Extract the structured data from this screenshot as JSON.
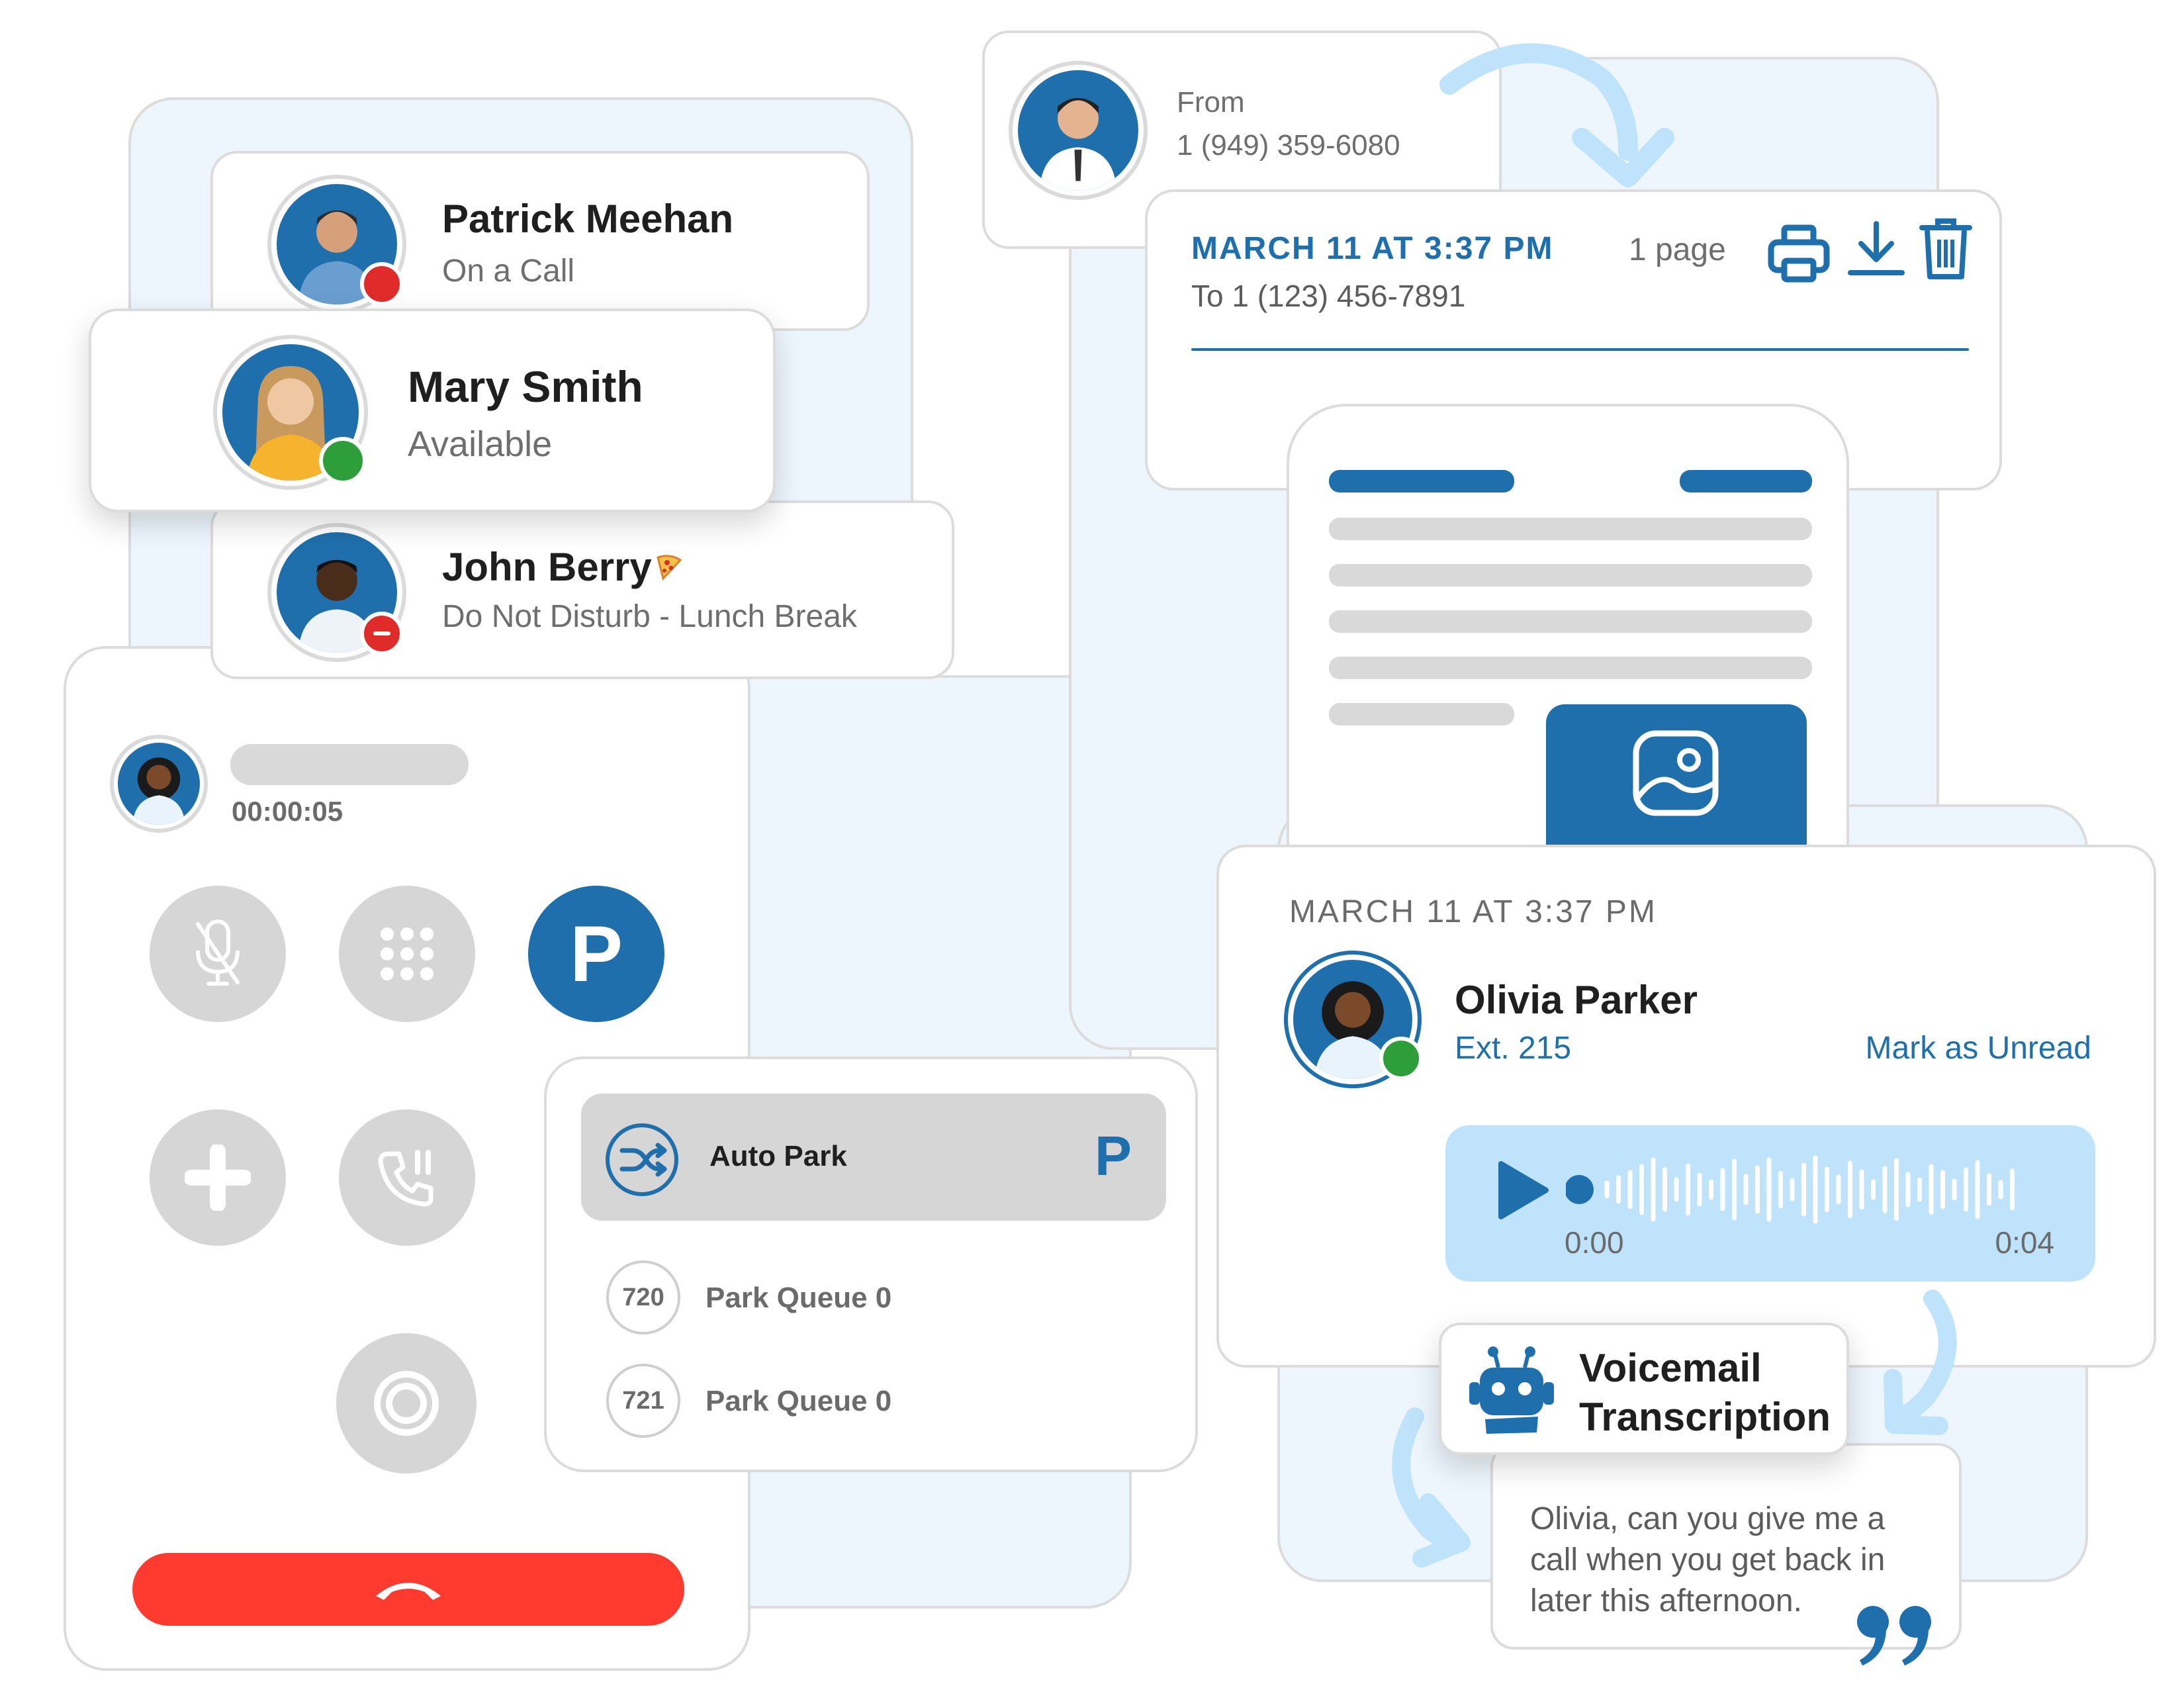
{
  "presence": {
    "contacts": [
      {
        "name": "Patrick Meehan",
        "status": "On a Call",
        "status_color": "#e02b2b"
      },
      {
        "name": "Mary Smith",
        "status": "Available",
        "status_color": "#2e9e3a"
      },
      {
        "name": "John Berry",
        "status": "Do Not Disturb - Lunch Break",
        "status_color": "#e02b2b",
        "emoji": "🍕"
      }
    ]
  },
  "call": {
    "timer": "00:00:05",
    "park_letter": "P",
    "colors": {
      "park": "#1e6fac",
      "hangup": "#ff3b30",
      "button": "#d6d6d6"
    }
  },
  "park_menu": {
    "auto_park_label": "Auto Park",
    "auto_park_letter": "P",
    "queues": [
      {
        "ext": "720",
        "label": "Park Queue 0"
      },
      {
        "ext": "721",
        "label": "Park Queue 0"
      }
    ]
  },
  "fax": {
    "from_label": "From",
    "from_number": "1 (949) 359-6080",
    "date": "MARCH 11 AT 3:37 PM",
    "to": "To 1 (123) 456-7891",
    "pages": "1 page",
    "accent": "#1e6fac"
  },
  "voicemail": {
    "date": "MARCH 11 AT 3:37 PM",
    "caller": "Olivia Parker",
    "ext": "Ext. 215",
    "mark_unread": "Mark as Unread",
    "time_start": "0:00",
    "time_end": "0:04",
    "player_bg": "#bfe3fa",
    "transcription_title_line1": "Voicemail",
    "transcription_title_line2": "Transcription",
    "transcript": "Olivia, can you give me a call when you get back in later this afternoon."
  }
}
